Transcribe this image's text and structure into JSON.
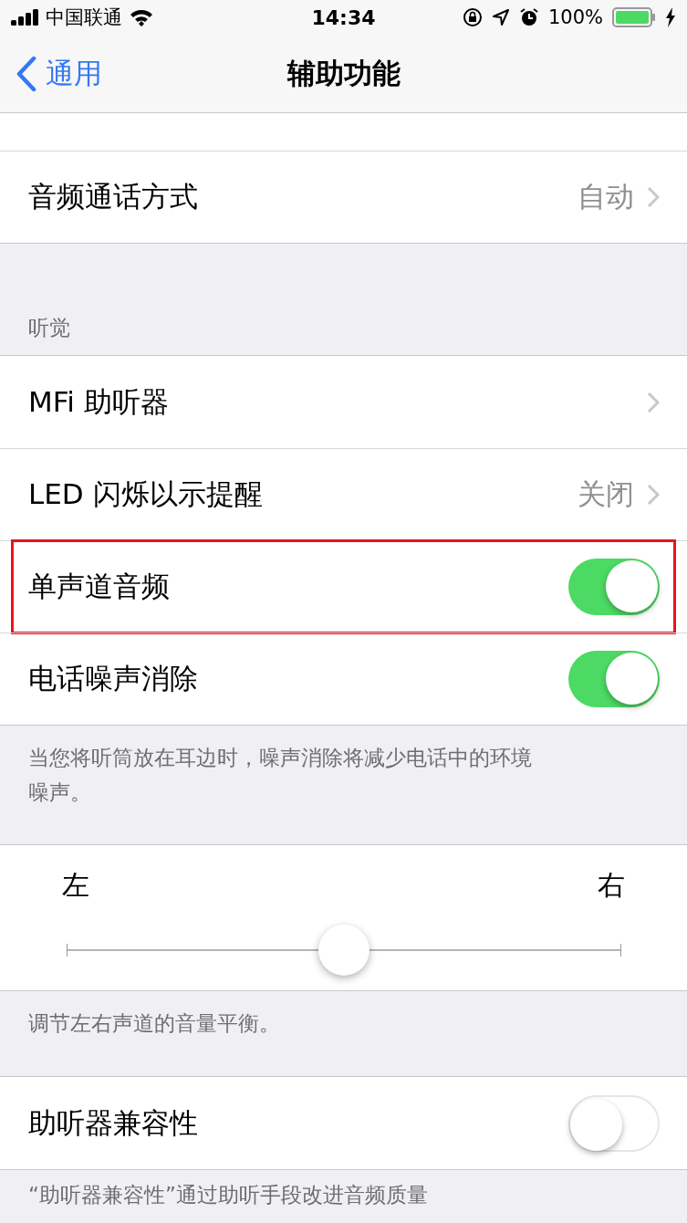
{
  "status_bar": {
    "carrier": "中国联通",
    "time": "14:34",
    "battery": "100%"
  },
  "nav": {
    "back": "通用",
    "title": "辅助功能"
  },
  "top_rows": [
    {
      "kind": "blank"
    },
    {
      "kind": "link",
      "label": "音频通话方式",
      "value": "自动"
    }
  ],
  "hearing": {
    "header": "听觉",
    "rows": [
      {
        "kind": "link",
        "label": "MFi 助听器",
        "highlighted": false
      },
      {
        "kind": "link",
        "label": "LED 闪烁以示提醒",
        "value": "关闭",
        "highlighted": false
      },
      {
        "kind": "toggle",
        "label": "单声道音频",
        "on": true,
        "highlighted": true
      },
      {
        "kind": "toggle",
        "label": "电话噪声消除",
        "on": true,
        "highlighted": false
      }
    ],
    "footer": "当您将听筒放在耳边时，噪声消除将减少电话中的环境噪声。"
  },
  "balance": {
    "left": "左",
    "right": "右",
    "level": 0.5,
    "footer": "调节左右声道的音量平衡。"
  },
  "compat": {
    "rows": [
      {
        "kind": "toggle",
        "label": "助听器兼容性",
        "on": false,
        "highlighted": false
      }
    ],
    "footer": "“助听器兼容性”通过助听手段改进音频质量"
  }
}
